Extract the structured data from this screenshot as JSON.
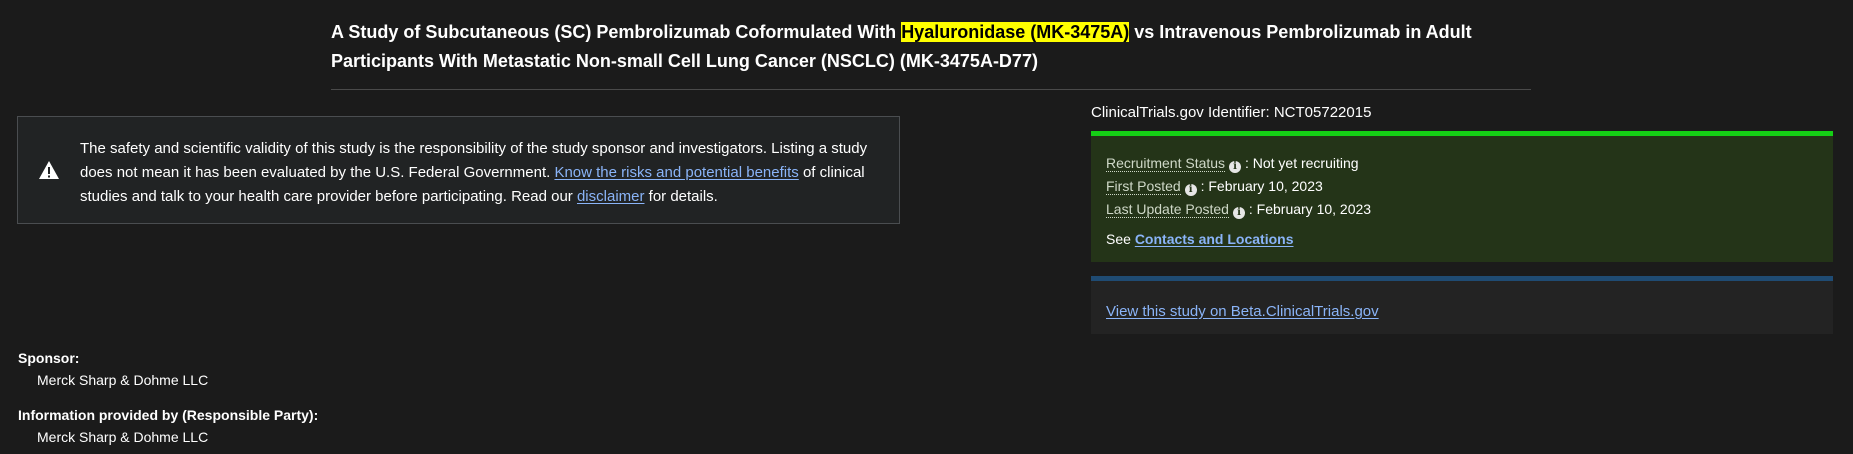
{
  "study": {
    "title_before": "A Study of Subcutaneous (SC) Pembrolizumab Coformulated With ",
    "title_highlight": "Hyaluronidase (MK-3475A)",
    "title_after": " vs Intravenous Pembrolizumab in Adult Participants With Metastatic Non-small Cell Lung Cancer (NSCLC) (MK-3475A-D77)",
    "highlight_color": "#ffff00"
  },
  "disclaimer": {
    "icon": "warning-icon",
    "text_before": "The safety and scientific validity of this study is the responsibility of the study sponsor and investigators. Listing a study does not mean it has been evaluated by the U.S. Federal Government. ",
    "risks_link": "Know the risks and potential benefits",
    "text_middle": " of clinical studies and talk to your health care provider before participating. Read our ",
    "disclaimer_link": "disclaimer",
    "text_after": " for details."
  },
  "identifier": {
    "label": "ClinicalTrials.gov Identifier: ",
    "value": "NCT05722015"
  },
  "status": {
    "accent_color": "#15d015",
    "recruitment_label": "Recruitment Status",
    "recruitment_value": ": Not yet recruiting",
    "first_posted_label": "First Posted",
    "first_posted_value": ": February 10, 2023",
    "last_update_label": "Last Update Posted",
    "last_update_value": ": February 10, 2023",
    "see_prefix": "See ",
    "contacts_link": "Contacts and Locations",
    "info_icon": "info-icon"
  },
  "beta": {
    "accent_color": "#1f4b73",
    "link": "View this study on Beta.ClinicalTrials.gov"
  },
  "sponsor": {
    "label": "Sponsor:",
    "value": "Merck Sharp & Dohme LLC"
  },
  "responsible_party": {
    "label": "Information provided by (Responsible Party):",
    "value": "Merck Sharp & Dohme LLC"
  }
}
